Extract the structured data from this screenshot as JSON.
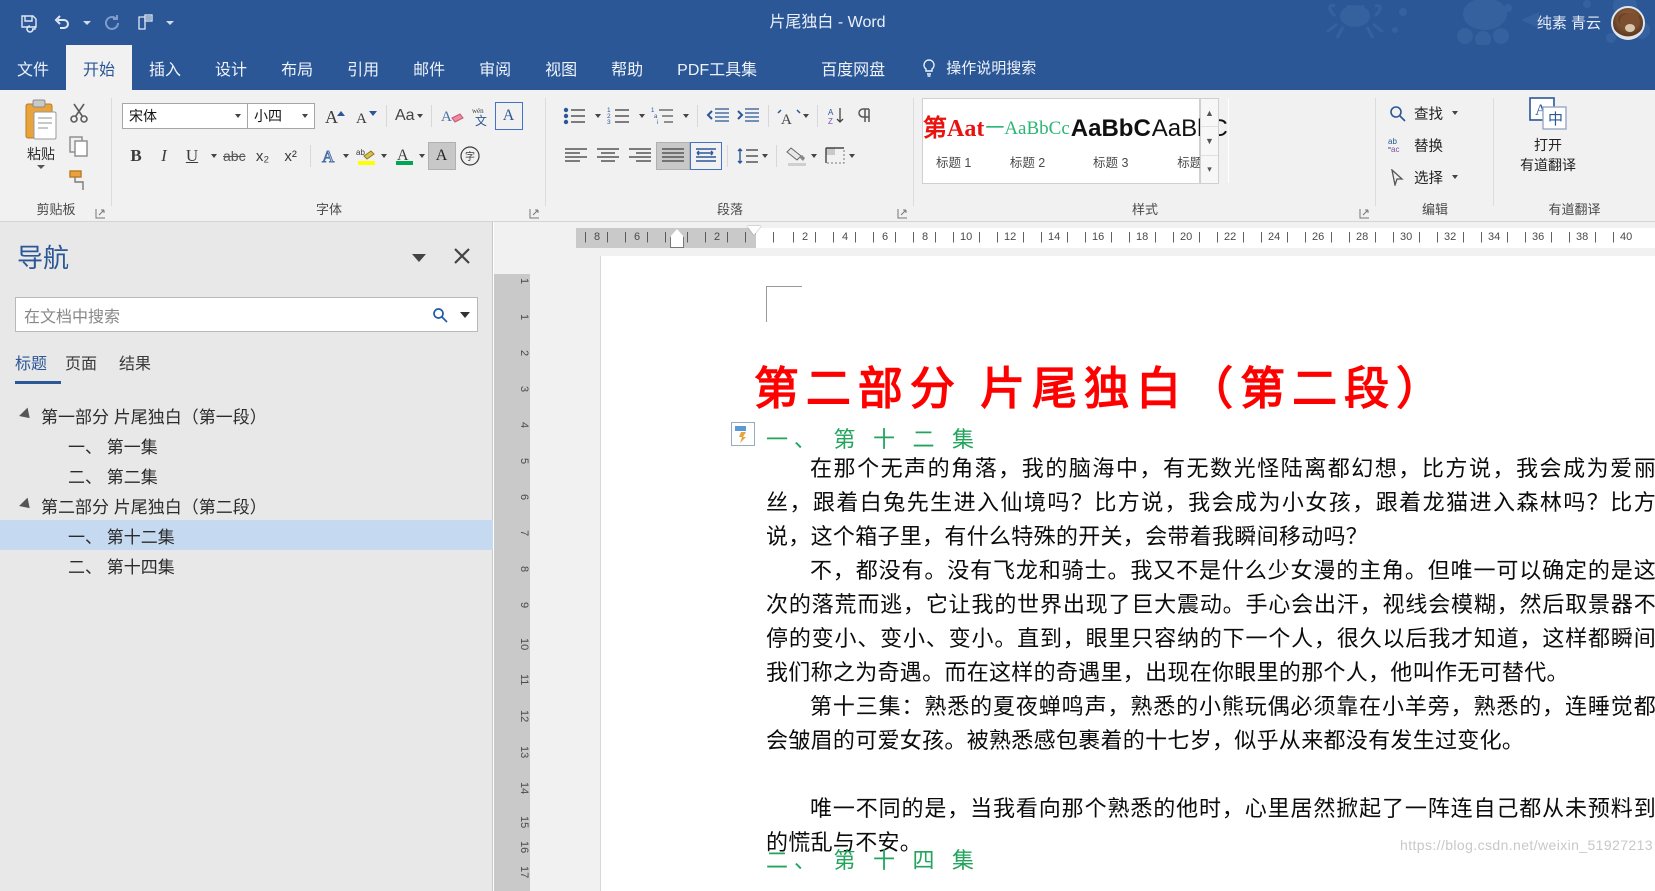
{
  "titlebar": {
    "document_title": "片尾独白  -  Word",
    "user_name": "纯素 青云",
    "quick_access": [
      {
        "name": "save-icon",
        "label": "保存"
      },
      {
        "name": "undo-icon",
        "label": "撤消"
      },
      {
        "name": "redo-icon",
        "label": "恢复"
      },
      {
        "name": "format-painter-quick-icon",
        "label": "格式刷"
      },
      {
        "name": "customize-qat-icon",
        "label": "自定义快速访问工具栏"
      }
    ],
    "accent_color": "#2b5797"
  },
  "tabs": [
    {
      "label": "文件",
      "active": false
    },
    {
      "label": "开始",
      "active": true
    },
    {
      "label": "插入",
      "active": false
    },
    {
      "label": "设计",
      "active": false
    },
    {
      "label": "布局",
      "active": false
    },
    {
      "label": "引用",
      "active": false
    },
    {
      "label": "邮件",
      "active": false
    },
    {
      "label": "审阅",
      "active": false
    },
    {
      "label": "视图",
      "active": false
    },
    {
      "label": "帮助",
      "active": false
    },
    {
      "label": "PDF工具集",
      "active": false
    },
    {
      "label": "百度网盘",
      "active": false
    }
  ],
  "tell_me": {
    "label": "操作说明搜索",
    "icon": "lightbulb-icon"
  },
  "ribbon": {
    "clipboard": {
      "group_label": "剪贴板",
      "paste_label": "粘贴",
      "cut_label": "剪切",
      "copy_label": "复制",
      "format_painter_label": "格式刷"
    },
    "font": {
      "group_label": "字体",
      "font_name": "宋体",
      "font_size": "小四",
      "grow_label": "增大字号",
      "shrink_label": "减小字号",
      "change_case_label": "更改大小写",
      "clear_format_label": "清除所有格式",
      "phonetic_label": "拼音指南",
      "char_border_label": "字符边框",
      "bold_label": "B",
      "italic_label": "I",
      "underline_label": "U",
      "strike_label": "abc",
      "subscript_label": "x₂",
      "superscript_label": "x²",
      "text_effects_label": "文本效果和版式",
      "highlight_label": "文本突出显示颜色",
      "font_color_label": "字体颜色",
      "shading_char_label": "字符底纹",
      "circle_char_label": "带圈字符"
    },
    "paragraph": {
      "group_label": "段落",
      "bullets_label": "项目符号",
      "numbering_label": "编号",
      "multilevel_label": "多级列表",
      "decrease_indent_label": "减少缩进量",
      "increase_indent_label": "增加缩进量",
      "asian_layout_label": "中文版式",
      "sort_label": "排序",
      "show_marks_label": "显示编辑标记",
      "align_left_label": "左对齐",
      "align_center_label": "居中",
      "align_right_label": "右对齐",
      "justify_label": "两端对齐",
      "distributed_label": "分散对齐",
      "line_spacing_label": "行和段落间距",
      "shading_label": "底纹",
      "borders_label": "边框"
    },
    "styles": {
      "group_label": "样式",
      "items": [
        {
          "preview": "第Aat",
          "name": "标题 1",
          "color": "#e8120f"
        },
        {
          "preview": "一AaBbCc",
          "name": "标题 2",
          "color": "#2bb673"
        },
        {
          "preview": "AaBbC",
          "name": "标题 3",
          "color": "#111111"
        },
        {
          "preview": "AaBbC",
          "name": "标题",
          "color": "#111111"
        }
      ],
      "scroll_up": "▲",
      "scroll_down": "▼",
      "more": "▾"
    },
    "editing": {
      "group_label": "编辑",
      "find_label": "查找",
      "replace_label": "替换",
      "select_label": "选择"
    },
    "youdao": {
      "group_label": "有道翻译",
      "button_line1": "打开",
      "button_line2": "有道翻译"
    }
  },
  "navigation": {
    "title": "导航",
    "search_placeholder": "在文档中搜索",
    "tabs": [
      {
        "label": "标题",
        "selected": true
      },
      {
        "label": "页面",
        "selected": false
      },
      {
        "label": "结果",
        "selected": false
      }
    ],
    "tree": [
      {
        "label": "第一部分 片尾独白（第一段）",
        "level": 1,
        "expandable": true,
        "selected": false
      },
      {
        "label": "一、  第一集",
        "level": 2,
        "expandable": false,
        "selected": false
      },
      {
        "label": "二、  第二集",
        "level": 2,
        "expandable": false,
        "selected": false
      },
      {
        "label": "第二部分 片尾独白（第二段）",
        "level": 1,
        "expandable": true,
        "selected": false
      },
      {
        "label": "一、  第十二集",
        "level": 2,
        "expandable": false,
        "selected": true
      },
      {
        "label": "二、  第十四集",
        "level": 2,
        "expandable": false,
        "selected": false
      }
    ]
  },
  "ruler": {
    "corner_tab_icon": "left-tab-stop-icon",
    "horizontal_ticks": [
      "8",
      "6",
      "4",
      "2",
      "2",
      "4",
      "6",
      "8",
      "10",
      "12",
      "14",
      "16",
      "18",
      "20",
      "22",
      "24",
      "26",
      "28",
      "30",
      "32",
      "34",
      "36",
      "38",
      "40"
    ],
    "vertical_ticks": [
      "1",
      "1",
      "2",
      "3",
      "4",
      "5",
      "6",
      "7",
      "8",
      "9",
      "10",
      "11",
      "12",
      "13",
      "14",
      "15",
      "16",
      "17",
      "18"
    ]
  },
  "document": {
    "heading1": "第二部分 片尾独白（第二段）",
    "heading1_color": "#ff0000",
    "heading2_color": "#22a45d",
    "sections": [
      {
        "heading": "一、   第 十 二 集",
        "paragraphs": [
          "在那个无声的角落，我的脑海中，有无数光怪陆离都幻想，比方说，我会成为爱丽丝，跟着白兔先生进入仙境吗？比方说，我会成为小女孩，跟着龙猫进入森林吗？比方说，这个箱子里，有什么特殊的开关，会带着我瞬间移动吗？",
          "不，都没有。没有飞龙和骑士。我又不是什么少女漫的主角。但唯一可以确定的是这次的落荒而逃，它让我的世界出现了巨大震动。手心会出汗，视线会模糊，然后取景器不停的变小、变小、变小。直到，眼里只容纳的下一个人，很久以后我才知道，这样都瞬间我们称之为奇遇。而在这样的奇遇里，出现在你眼里的那个人，他叫作无可替代。",
          "第十三集：熟悉的夏夜蝉鸣声，熟悉的小熊玩偶必须靠在小羊旁，熟悉的，连睡觉都会皱眉的可爱女孩。被熟悉感包裹着的十七岁，似乎从来都没有发生过变化。",
          "唯一不同的是，当我看向那个熟悉的他时，心里居然掀起了一阵连自己都从未预料到的慌乱与不安。"
        ]
      },
      {
        "heading": "二、   第 十 四 集",
        "paragraphs": []
      }
    ]
  },
  "watermark": {
    "text": "https://blog.csdn.net/weixin_51927213"
  }
}
